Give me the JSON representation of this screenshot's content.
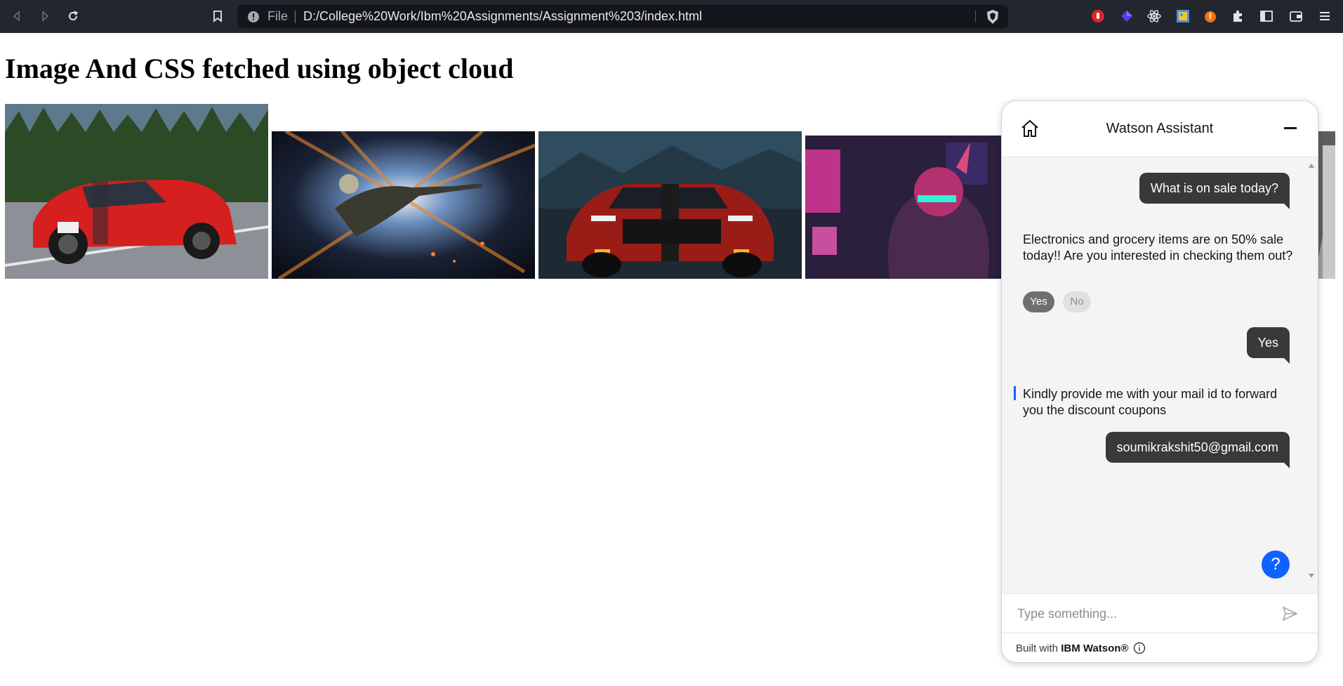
{
  "browser": {
    "url_scheme": "File",
    "url": "D:/College%20Work/Ibm%20Assignments/Assignment%203/index.html"
  },
  "page": {
    "heading": "Image And CSS fetched using object cloud",
    "images": [
      {
        "name": "red-mustang-convertible-image"
      },
      {
        "name": "sniper-artwork-image"
      },
      {
        "name": "red-shelby-mustang-image"
      },
      {
        "name": "cyberpunk-warrior-image"
      },
      {
        "name": "partial-image"
      }
    ]
  },
  "watson": {
    "title": "Watson Assistant",
    "messages": {
      "user_1": "What is on sale today?",
      "bot_1": "Electronics and grocery items are on 50% sale today!! Are you interested in checking them out?",
      "option_yes": "Yes",
      "option_no": "No",
      "user_2": "Yes",
      "bot_2": "Kindly provide me with your mail id to forward you the discount coupons",
      "user_3": "soumikrakshit50@gmail.com"
    },
    "help_label": "?",
    "input_placeholder": "Type something...",
    "footer_prefix": "Built with ",
    "footer_brand": "IBM Watson®"
  },
  "colors": {
    "accent": "#0f62fe",
    "user_bubble": "#393939",
    "browser_bar": "#23262f"
  }
}
